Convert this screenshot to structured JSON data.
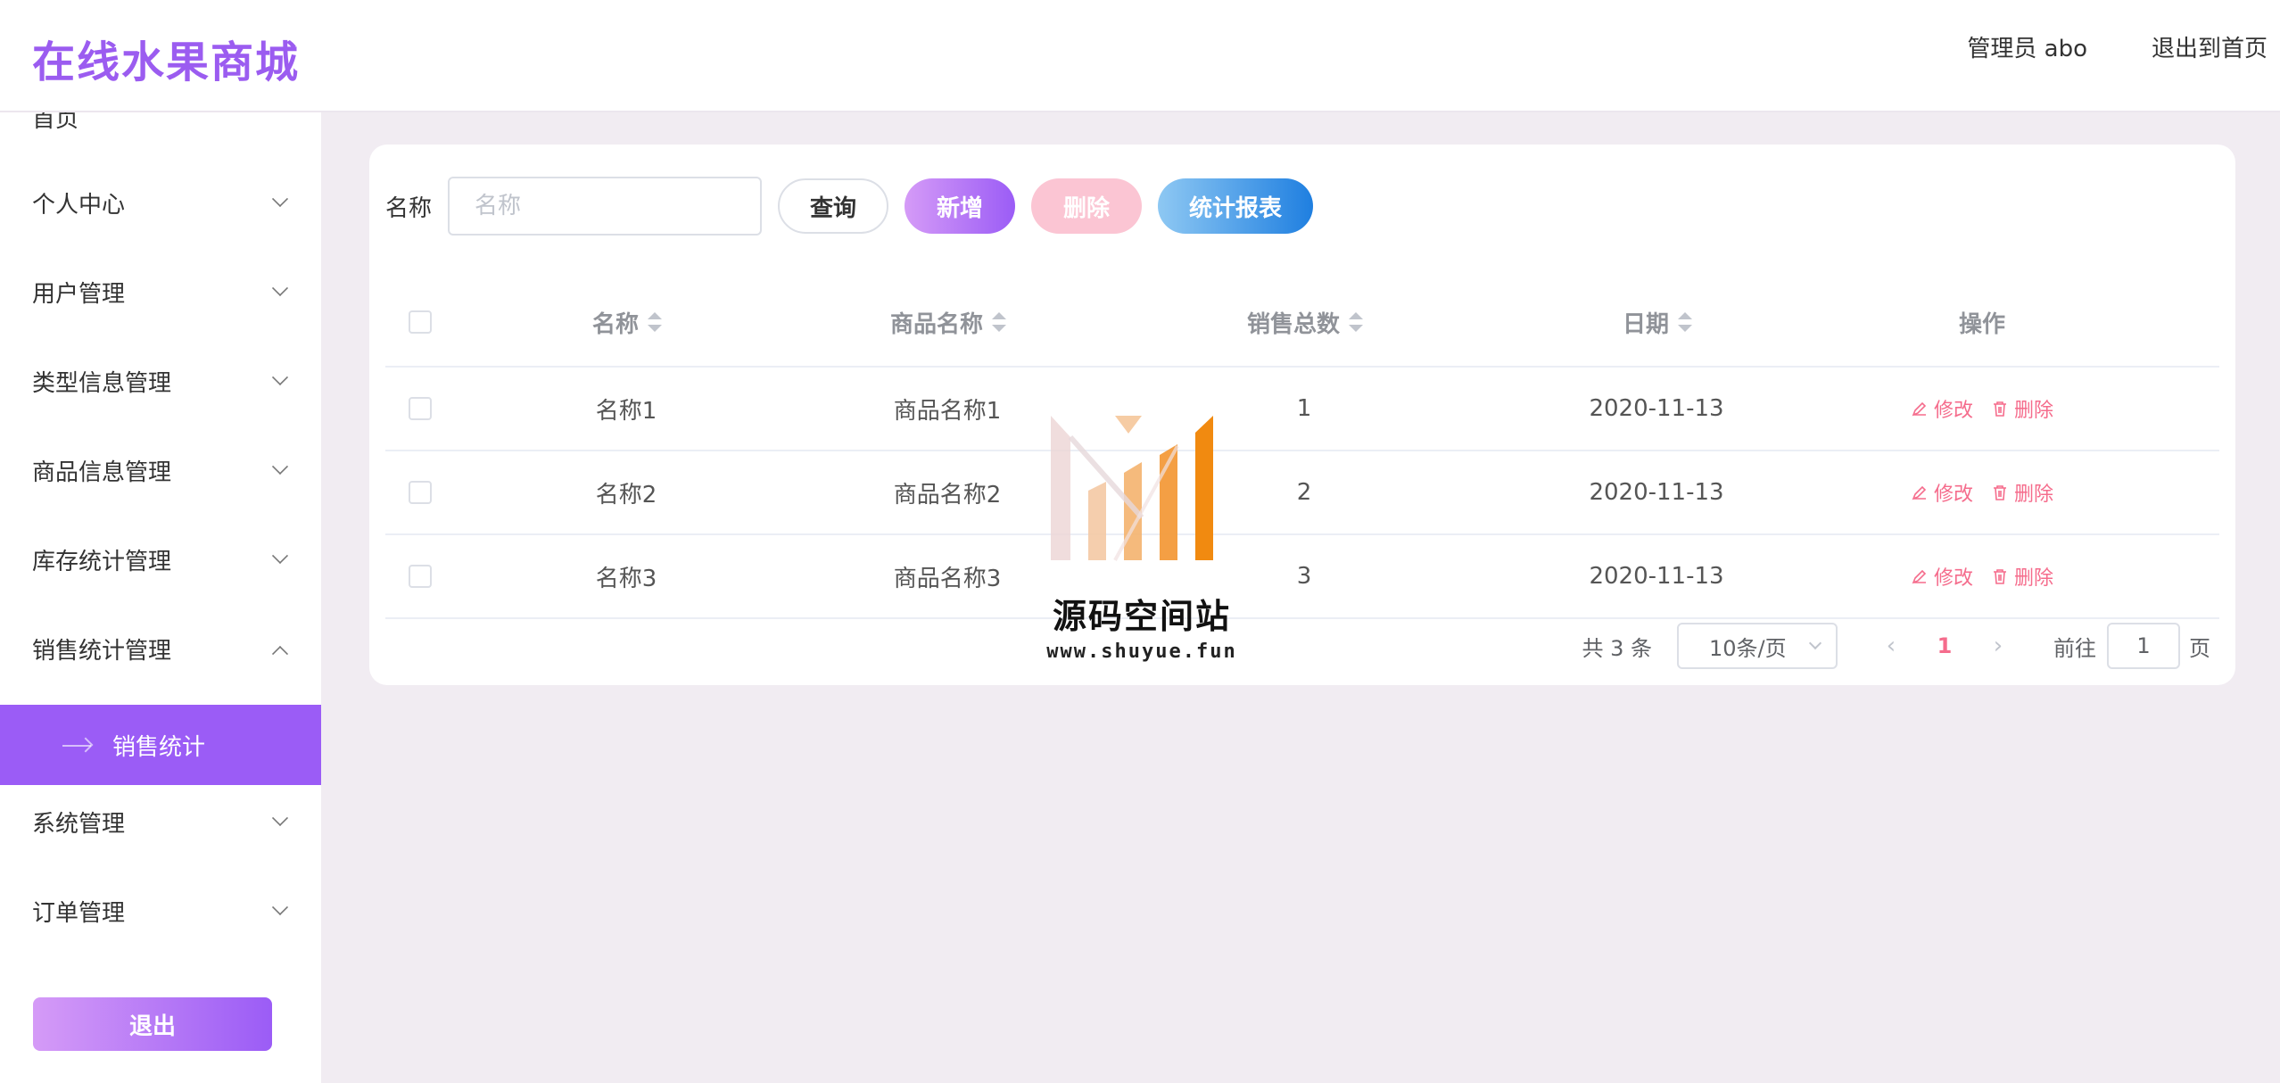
{
  "header": {
    "logo": "在线水果商城",
    "admin": "管理员 abo",
    "exit_home": "退出到首页"
  },
  "sidebar": {
    "items": [
      {
        "label": "首页"
      },
      {
        "label": "个人中心"
      },
      {
        "label": "用户管理"
      },
      {
        "label": "类型信息管理"
      },
      {
        "label": "商品信息管理"
      },
      {
        "label": "库存统计管理"
      },
      {
        "label": "销售统计管理"
      },
      {
        "label": "系统管理"
      },
      {
        "label": "订单管理"
      }
    ],
    "active_sub": "销售统计",
    "logout": "退出"
  },
  "search": {
    "label": "名称",
    "placeholder": "名称",
    "query": "查询",
    "add": "新增",
    "delete": "删除",
    "report": "统计报表"
  },
  "table": {
    "headers": [
      "名称",
      "商品名称",
      "销售总数",
      "日期",
      "操作"
    ],
    "rows": [
      {
        "name": "名称1",
        "goods": "商品名称1",
        "total": "1",
        "date": "2020-11-13"
      },
      {
        "name": "名称2",
        "goods": "商品名称2",
        "total": "2",
        "date": "2020-11-13"
      },
      {
        "name": "名称3",
        "goods": "商品名称3",
        "total": "3",
        "date": "2020-11-13"
      }
    ],
    "edit": "修改",
    "remove": "删除"
  },
  "pager": {
    "total": "共 3 条",
    "size": "10条/页",
    "current": "1",
    "goto": "前往",
    "goto_value": "1",
    "suffix": "页"
  },
  "watermark": {
    "text": "源码空间站",
    "url": "www.shuyue.fun"
  }
}
